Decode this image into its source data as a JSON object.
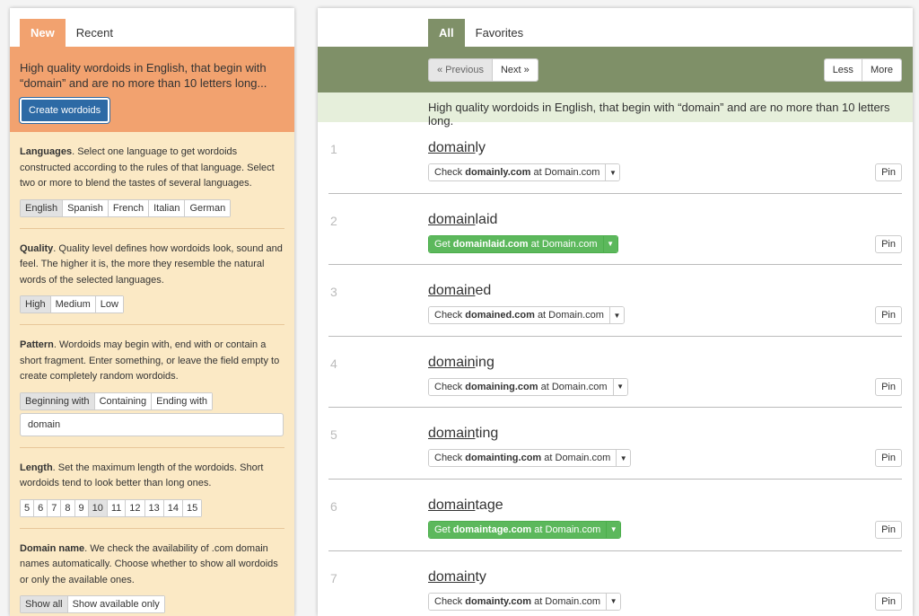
{
  "left_tabs": [
    "New",
    "Recent"
  ],
  "hero": {
    "text": "High quality wordoids in English, that begin with “domain” and are no more than 10 letters long...",
    "create_button": "Create wordoids"
  },
  "languages": {
    "title": "Languages",
    "desc": ". Select one language to get wordoids constructed according to the rules of that language. Select two or more to blend the tastes of several languages.",
    "options": [
      "English",
      "Spanish",
      "French",
      "Italian",
      "German"
    ],
    "selected": "English"
  },
  "quality": {
    "title": "Quality",
    "desc": ". Quality level defines how wordoids look, sound and feel. The higher it is, the more they resemble the natural words of the selected languages.",
    "options": [
      "High",
      "Medium",
      "Low"
    ],
    "selected": "High"
  },
  "pattern": {
    "title": "Pattern",
    "desc": ". Wordoids may begin with, end with or contain a short fragment. Enter something, or leave the field empty to create completely random wordoids.",
    "options": [
      "Beginning with",
      "Containing",
      "Ending with"
    ],
    "selected": "Beginning with",
    "value": "domain"
  },
  "length": {
    "title": "Length",
    "desc": ". Set the maximum length of the wordoids. Short wordoids tend to look better than long ones.",
    "options": [
      "5",
      "6",
      "7",
      "8",
      "9",
      "10",
      "11",
      "12",
      "13",
      "14",
      "15"
    ],
    "selected": "10"
  },
  "domain": {
    "title": "Domain name",
    "desc": ". We check the availability of .com domain names automatically. Choose whether to show all wordoids or only the available ones.",
    "options": [
      "Show all",
      "Show available only"
    ],
    "selected": "Show all"
  },
  "right_tabs": [
    "All",
    "Favorites"
  ],
  "pager": {
    "prev": "« Previous",
    "next": "Next »",
    "less": "Less",
    "more": "More"
  },
  "results_note": "High quality wordoids in English, that begin with “domain” and are no more than 10 letters long.",
  "results": [
    {
      "num": "1",
      "prefix": "domain",
      "suffix": "ly",
      "status": "check",
      "domain": "domainly.com"
    },
    {
      "num": "2",
      "prefix": "domain",
      "suffix": "laid",
      "status": "get",
      "domain": "domainlaid.com"
    },
    {
      "num": "3",
      "prefix": "domain",
      "suffix": "ed",
      "status": "check",
      "domain": "domained.com"
    },
    {
      "num": "4",
      "prefix": "domain",
      "suffix": "ing",
      "status": "check",
      "domain": "domaining.com"
    },
    {
      "num": "5",
      "prefix": "domain",
      "suffix": "ting",
      "status": "check",
      "domain": "domainting.com"
    },
    {
      "num": "6",
      "prefix": "domain",
      "suffix": "tage",
      "status": "get",
      "domain": "domaintage.com"
    },
    {
      "num": "7",
      "prefix": "domain",
      "suffix": "ty",
      "status": "check",
      "domain": "domainty.com"
    }
  ],
  "labels": {
    "check": "Check",
    "get": "Get",
    "at": "at Domain.com",
    "pin": "Pin"
  },
  "colors": {
    "orange": "#f2a26f",
    "cream": "#fbe9c5",
    "olive": "#7f9068",
    "green": "#5cb85c",
    "blue": "#2d6aa5"
  }
}
